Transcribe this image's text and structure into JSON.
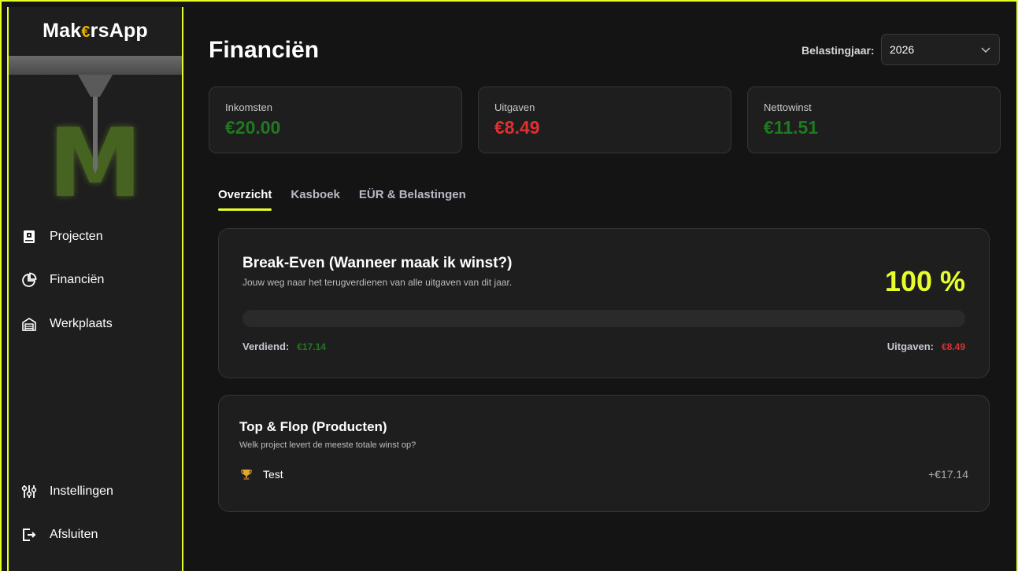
{
  "app": {
    "title_part1": "Mak",
    "title_euro": "€",
    "title_part2": "rsApp",
    "accent": "#e6ff2b"
  },
  "sidebar": {
    "items_top": [
      {
        "label": "Projecten",
        "icon": "book-icon"
      },
      {
        "label": "Financiën",
        "icon": "pie-chart-icon"
      },
      {
        "label": "Werkplaats",
        "icon": "garage-icon"
      }
    ],
    "items_bottom": [
      {
        "label": "Instellingen",
        "icon": "sliders-icon"
      },
      {
        "label": "Afsluiten",
        "icon": "logout-icon"
      }
    ]
  },
  "header": {
    "title": "Financiën",
    "year_label": "Belastingjaar:",
    "year_value": "2026"
  },
  "stats": [
    {
      "label": "Inkomsten",
      "value": "€20.00",
      "color": "#1f7a1f"
    },
    {
      "label": "Uitgaven",
      "value": "€8.49",
      "color": "#e03030"
    },
    {
      "label": "Nettowinst",
      "value": "€11.51",
      "color": "#1f7a1f"
    }
  ],
  "tabs": [
    {
      "label": "Overzicht",
      "active": true
    },
    {
      "label": "Kasboek",
      "active": false
    },
    {
      "label": "EÜR & Belastingen",
      "active": false
    }
  ],
  "break_even": {
    "title": "Break-Even (Wanneer maak ik winst?)",
    "subtitle": "Jouw weg naar het terugverdienen van alle uitgaven van dit jaar.",
    "percent": "100 %",
    "earned_label": "Verdiend:",
    "earned_value": "€17.14",
    "expenses_label": "Uitgaven:",
    "expenses_value": "€8.49"
  },
  "top_flop": {
    "title": "Top & Flop (Producten)",
    "subtitle": "Welk project levert de meeste totale winst op?",
    "items": [
      {
        "name": "Test",
        "value": "+€17.14",
        "icon": "trophy-icon"
      }
    ]
  }
}
